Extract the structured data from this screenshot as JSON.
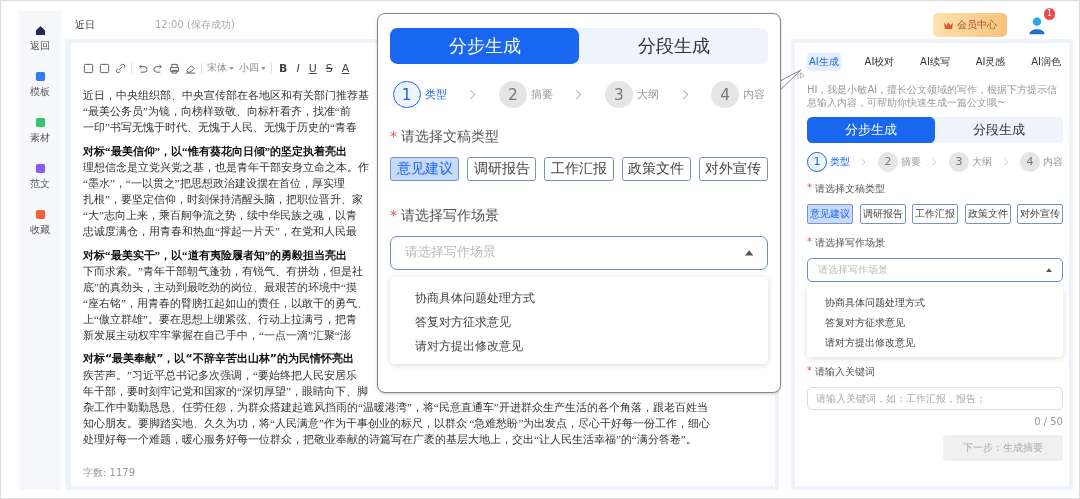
{
  "nav": [
    {
      "label": "返回"
    },
    {
      "label": "模板"
    },
    {
      "label": "素材"
    },
    {
      "label": "范文"
    },
    {
      "label": "收藏"
    }
  ],
  "header": {
    "title": "近日",
    "status": "12:00 (保存成功)",
    "member_button": "会员中心",
    "badge": "1"
  },
  "toolbar": {
    "font": "宋体",
    "size": "小四",
    "format_buttons": [
      "B",
      "I",
      "U",
      "S",
      "A"
    ]
  },
  "document": {
    "paragraphs": [
      {
        "lines": [
          {
            "kind": "body",
            "text": "近日，中央组织部、中央宣传部在各地区和有关部门推荐基"
          },
          {
            "kind": "body",
            "text": "“最美公务员”为镜，向榜样致敬、向标杆看齐，找准“前"
          },
          {
            "kind": "body",
            "text": "一印”书写无愧于时代、无愧于人民、无愧于历史的“青春"
          }
        ]
      },
      {
        "lines": [
          {
            "kind": "heading",
            "text": "对标“最美信仰”，以“惟有葵花向日倾”的坚定执着亮出"
          },
          {
            "kind": "body",
            "text": "理想信念是立党兴党之基，也是青年干部安身立命之本。作"
          },
          {
            "kind": "body",
            "text": "“墨水”，“一以贯之”把思想政治建设摆在首位，厚实理"
          },
          {
            "kind": "body",
            "text": "扎根”，要坚定信仰，时刻保持清醒头脑，把职位晋升、家"
          },
          {
            "kind": "body",
            "text": "“大”志向上来，乘百舸争流之势，续中华民族之魂，以青"
          },
          {
            "kind": "body",
            "text": "忠诚度满仓，用青春和热血“撑起一片天”，在党和人民最"
          }
        ]
      },
      {
        "lines": [
          {
            "kind": "heading",
            "text": "对标“最美实干”，以“道有夷险履者知”的勇毅担当亮出"
          },
          {
            "kind": "body",
            "text": "下而求索。”青年干部朝气蓬勃，有锐气、有拼劲，但是社"
          },
          {
            "kind": "body",
            "text": "底”的真劲头，主动到最吃劲的岗位、最艰苦的环境中“摸"
          },
          {
            "kind": "body",
            "text": "“座右铭”，用青春的臂膀扛起如山的责任，以敢干的勇气、"
          },
          {
            "kind": "body",
            "text": "上“傲立群雄”。要在思想上绷紧弦、行动上拉满弓，把青"
          },
          {
            "kind": "body",
            "text": "新发展主动权牢牢掌握在自己手中，“一点一滴”汇聚“澎"
          }
        ]
      },
      {
        "lines": [
          {
            "kind": "heading_sans",
            "text": "对标“最美奉献”，以“不辞辛苦出山林”的为民情怀亮出"
          },
          {
            "kind": "body",
            "text": "疾苦声。”习近平总书记多次强调，“要始终把人民安居乐"
          },
          {
            "kind": "body",
            "text": "年干部，要时刻牢记党和国家的“深切厚望”，眼睛向下、脚"
          },
          {
            "kind": "body",
            "text": "杂工作中勤勤恳恳、任劳任怨，为群众搭建起遮风挡雨的“温暖港湾”，将“民意直通车”开进群众生产生活的各个角落，跟老百姓当"
          },
          {
            "kind": "body",
            "text": "知心朋友。要脚踏实地、久久为功，将“人民满意”作为干事创业的标尺，以群众 “急难愁盼”为出发点，尽心干好每一份工作，细心"
          },
          {
            "kind": "body",
            "text": "处理好每一个难题，暖心服务好每一位群众，把敬业奉献的诗篇写在广袤的基层大地上，交出“让人民生活幸福”的“满分答卷”。"
          }
        ]
      }
    ],
    "word_count": "字数: 1179"
  },
  "popup": {
    "modes": [
      {
        "label": "分步生成",
        "selected": true
      },
      {
        "label": "分段生成",
        "selected": false
      }
    ],
    "steps": [
      {
        "number": "1",
        "label": "类型",
        "active": true
      },
      {
        "number": "2",
        "label": "摘要",
        "active": false
      },
      {
        "number": "3",
        "label": "大纲",
        "active": false
      },
      {
        "number": "4",
        "label": "内容",
        "active": false
      }
    ],
    "type_label": {
      "mark": "*",
      "text": "请选择文稿类型"
    },
    "types": [
      {
        "label": "意见建议",
        "selected": true
      },
      {
        "label": "调研报告",
        "selected": false
      },
      {
        "label": "工作汇报",
        "selected": false
      },
      {
        "label": "政策文件",
        "selected": false
      },
      {
        "label": "对外宣传",
        "selected": false
      }
    ],
    "scene_label": {
      "mark": "*",
      "text": "请选择写作场景"
    },
    "scene_select": {
      "placeholder": "请选择写作场景",
      "expanded": true
    },
    "scene_options": [
      "协商具体问题处理方式",
      "答复对方征求意见",
      "请对方提出修改意见"
    ]
  },
  "panel": {
    "tabs": [
      {
        "label": "AI生成",
        "selected": true
      },
      {
        "label": "AI校对",
        "selected": false
      },
      {
        "label": "AI续写",
        "selected": false
      },
      {
        "label": "AI灵感",
        "selected": false
      },
      {
        "label": "AI润色",
        "selected": false
      }
    ],
    "intro": "HI，我是小敏AI，擅长公文领域的写作，根据下方提示信息输入内容，可帮助你快速生成一篇公文哦~",
    "generator": {
      "modes": [
        {
          "label": "分步生成",
          "selected": true
        },
        {
          "label": "分段生成",
          "selected": false
        }
      ],
      "steps": [
        {
          "number": "1",
          "label": "类型",
          "active": true
        },
        {
          "number": "2",
          "label": "摘要",
          "active": false
        },
        {
          "number": "3",
          "label": "大纲",
          "active": false
        },
        {
          "number": "4",
          "label": "内容",
          "active": false
        }
      ],
      "type_label": {
        "mark": "*",
        "text": "请选择文稿类型"
      },
      "types": [
        {
          "label": "意见建议",
          "selected": true
        },
        {
          "label": "调研报告",
          "selected": false
        },
        {
          "label": "工作汇报",
          "selected": false
        },
        {
          "label": "政策文件",
          "selected": false
        },
        {
          "label": "对外宣传",
          "selected": false
        }
      ],
      "scene_label": {
        "mark": "*",
        "text": "请选择写作场景"
      },
      "scene_select": {
        "placeholder": "请选择写作场景",
        "expanded": true
      },
      "scene_options": [
        "协商具体问题处理方式",
        "答复对方征求意见",
        "请对方提出修改意见"
      ]
    },
    "keyword_label": {
      "mark": "*",
      "text": "请输入关键词"
    },
    "keyword_field": {
      "placeholder": "请输入关键词，如：工作汇报，报告；"
    },
    "counter": "0 / 50",
    "next_button": {
      "label": "下一步：生成摘要",
      "disabled": true
    }
  }
}
